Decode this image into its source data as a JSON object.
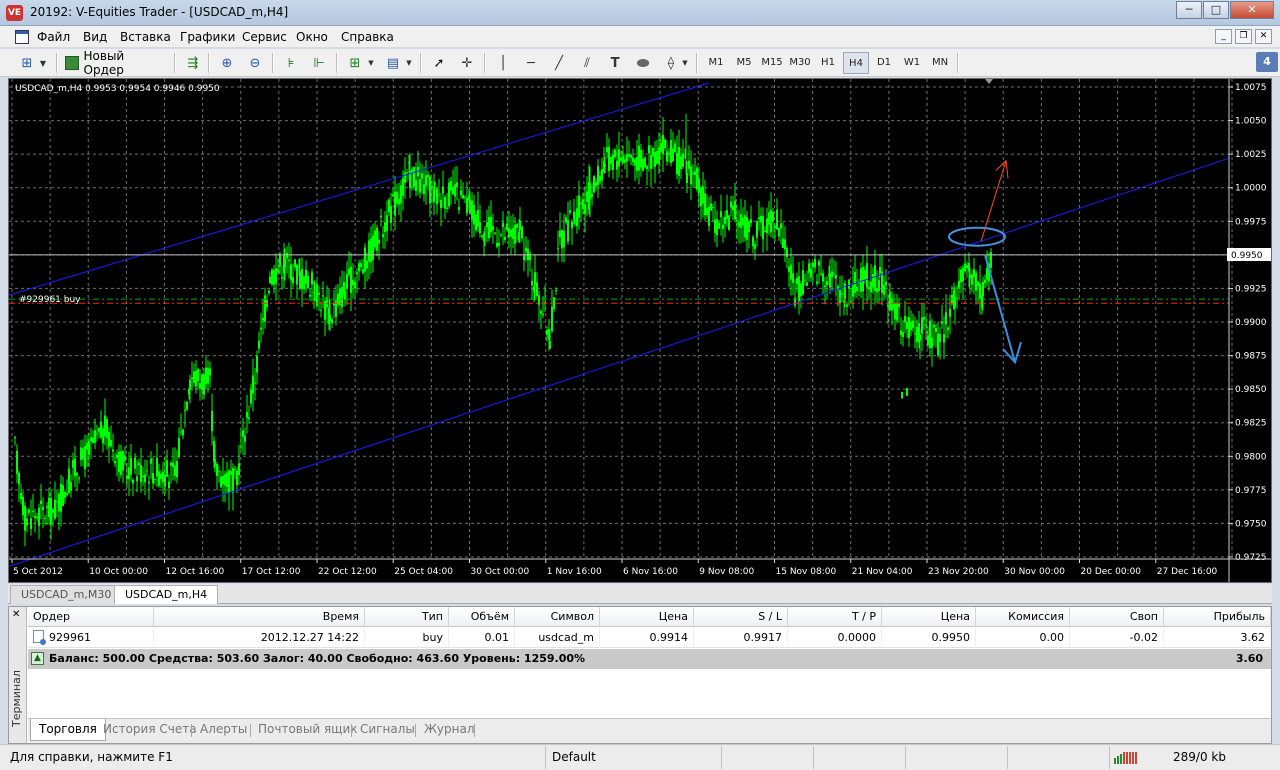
{
  "window": {
    "app_icon_text": "VE",
    "title": "20192: V-Equities Trader - [USDCAD_m,H4]",
    "minimize": "─",
    "maximize": "□",
    "close": "✕"
  },
  "menu": {
    "items": [
      "Файл",
      "Вид",
      "Вставка",
      "Графики",
      "Сервис",
      "Окно",
      "Справка"
    ],
    "mdi_minimize": "_",
    "mdi_restore": "❐",
    "mdi_close": "✕"
  },
  "toolbar": {
    "new_order_label": "Новый Ордер",
    "timeframes": [
      "M1",
      "M5",
      "M15",
      "M30",
      "H1",
      "H4",
      "D1",
      "W1",
      "MN"
    ],
    "active_timeframe": "H4",
    "badge": "4"
  },
  "chart": {
    "header": "USDCAD_m,H4  0.9953 0.9954 0.9946 0.9950",
    "order_label": "#929961 buy",
    "current_price": "0.9950",
    "price_ticks": [
      "1.0075",
      "1.0050",
      "1.0025",
      "1.0000",
      "0.9975",
      "0.9950",
      "0.9925",
      "0.9900",
      "0.9875",
      "0.9850",
      "0.9825",
      "0.9800",
      "0.9775",
      "0.9750",
      "0.9725"
    ],
    "time_ticks": [
      "5 Oct 2012",
      "10 Oct 00:00",
      "12 Oct 16:00",
      "17 Oct 12:00",
      "22 Oct 12:00",
      "25 Oct 04:00",
      "30 Oct 00:00",
      "1 Nov 16:00",
      "6 Nov 16:00",
      "9 Nov 08:00",
      "15 Nov 08:00",
      "21 Nov 04:00",
      "23 Nov 20:00",
      "30 Nov 00:00",
      "20 Dec 00:00",
      "27 Dec 16:00"
    ],
    "colors": {
      "background": "#000000",
      "candles": "#00ff00",
      "channel": "#1a1aff",
      "grid": "#6e6e6e",
      "entry_line": "#00aa00",
      "stop_line": "#ff2020",
      "price_line": "#c0c0c0",
      "arrow_up": "#ff4a2a",
      "arrow_down": "#3a8fe0",
      "ellipse": "#4a90e0"
    }
  },
  "chart_tabs": [
    {
      "label": "USDCAD_m,M30",
      "active": false
    },
    {
      "label": "USDCAD_m,H4",
      "active": true
    }
  ],
  "terminal": {
    "close": "✕",
    "side_label": "Терминал",
    "columns": [
      "Ордер",
      "Время",
      "Тип",
      "Объём",
      "Символ",
      "Цена",
      "S / L",
      "T / P",
      "Цена",
      "Комиссия",
      "Своп",
      "Прибыль"
    ],
    "order": {
      "ticket": "929961",
      "time": "2012.12.27 14:22",
      "type": "buy",
      "volume": "0.01",
      "symbol": "usdcad_m",
      "open_price": "0.9914",
      "sl": "0.9917",
      "tp": "0.0000",
      "price": "0.9950",
      "commission": "0.00",
      "swap": "-0.02",
      "profit": "3.62"
    },
    "balance_line": "Баланс: 500.00  Средства: 503.60  Залог: 40.00  Свободно: 463.60  Уровень: 1259.00%",
    "total_profit": "3.60",
    "tabs": [
      "Торговля",
      "История Счета",
      "Алерты",
      "Почтовый ящик",
      "Сигналы",
      "Журнал"
    ],
    "active_tab": "Торговля"
  },
  "status": {
    "help": "Для справки, нажмите F1",
    "profile": "Default",
    "traffic": "289/0 kb"
  }
}
